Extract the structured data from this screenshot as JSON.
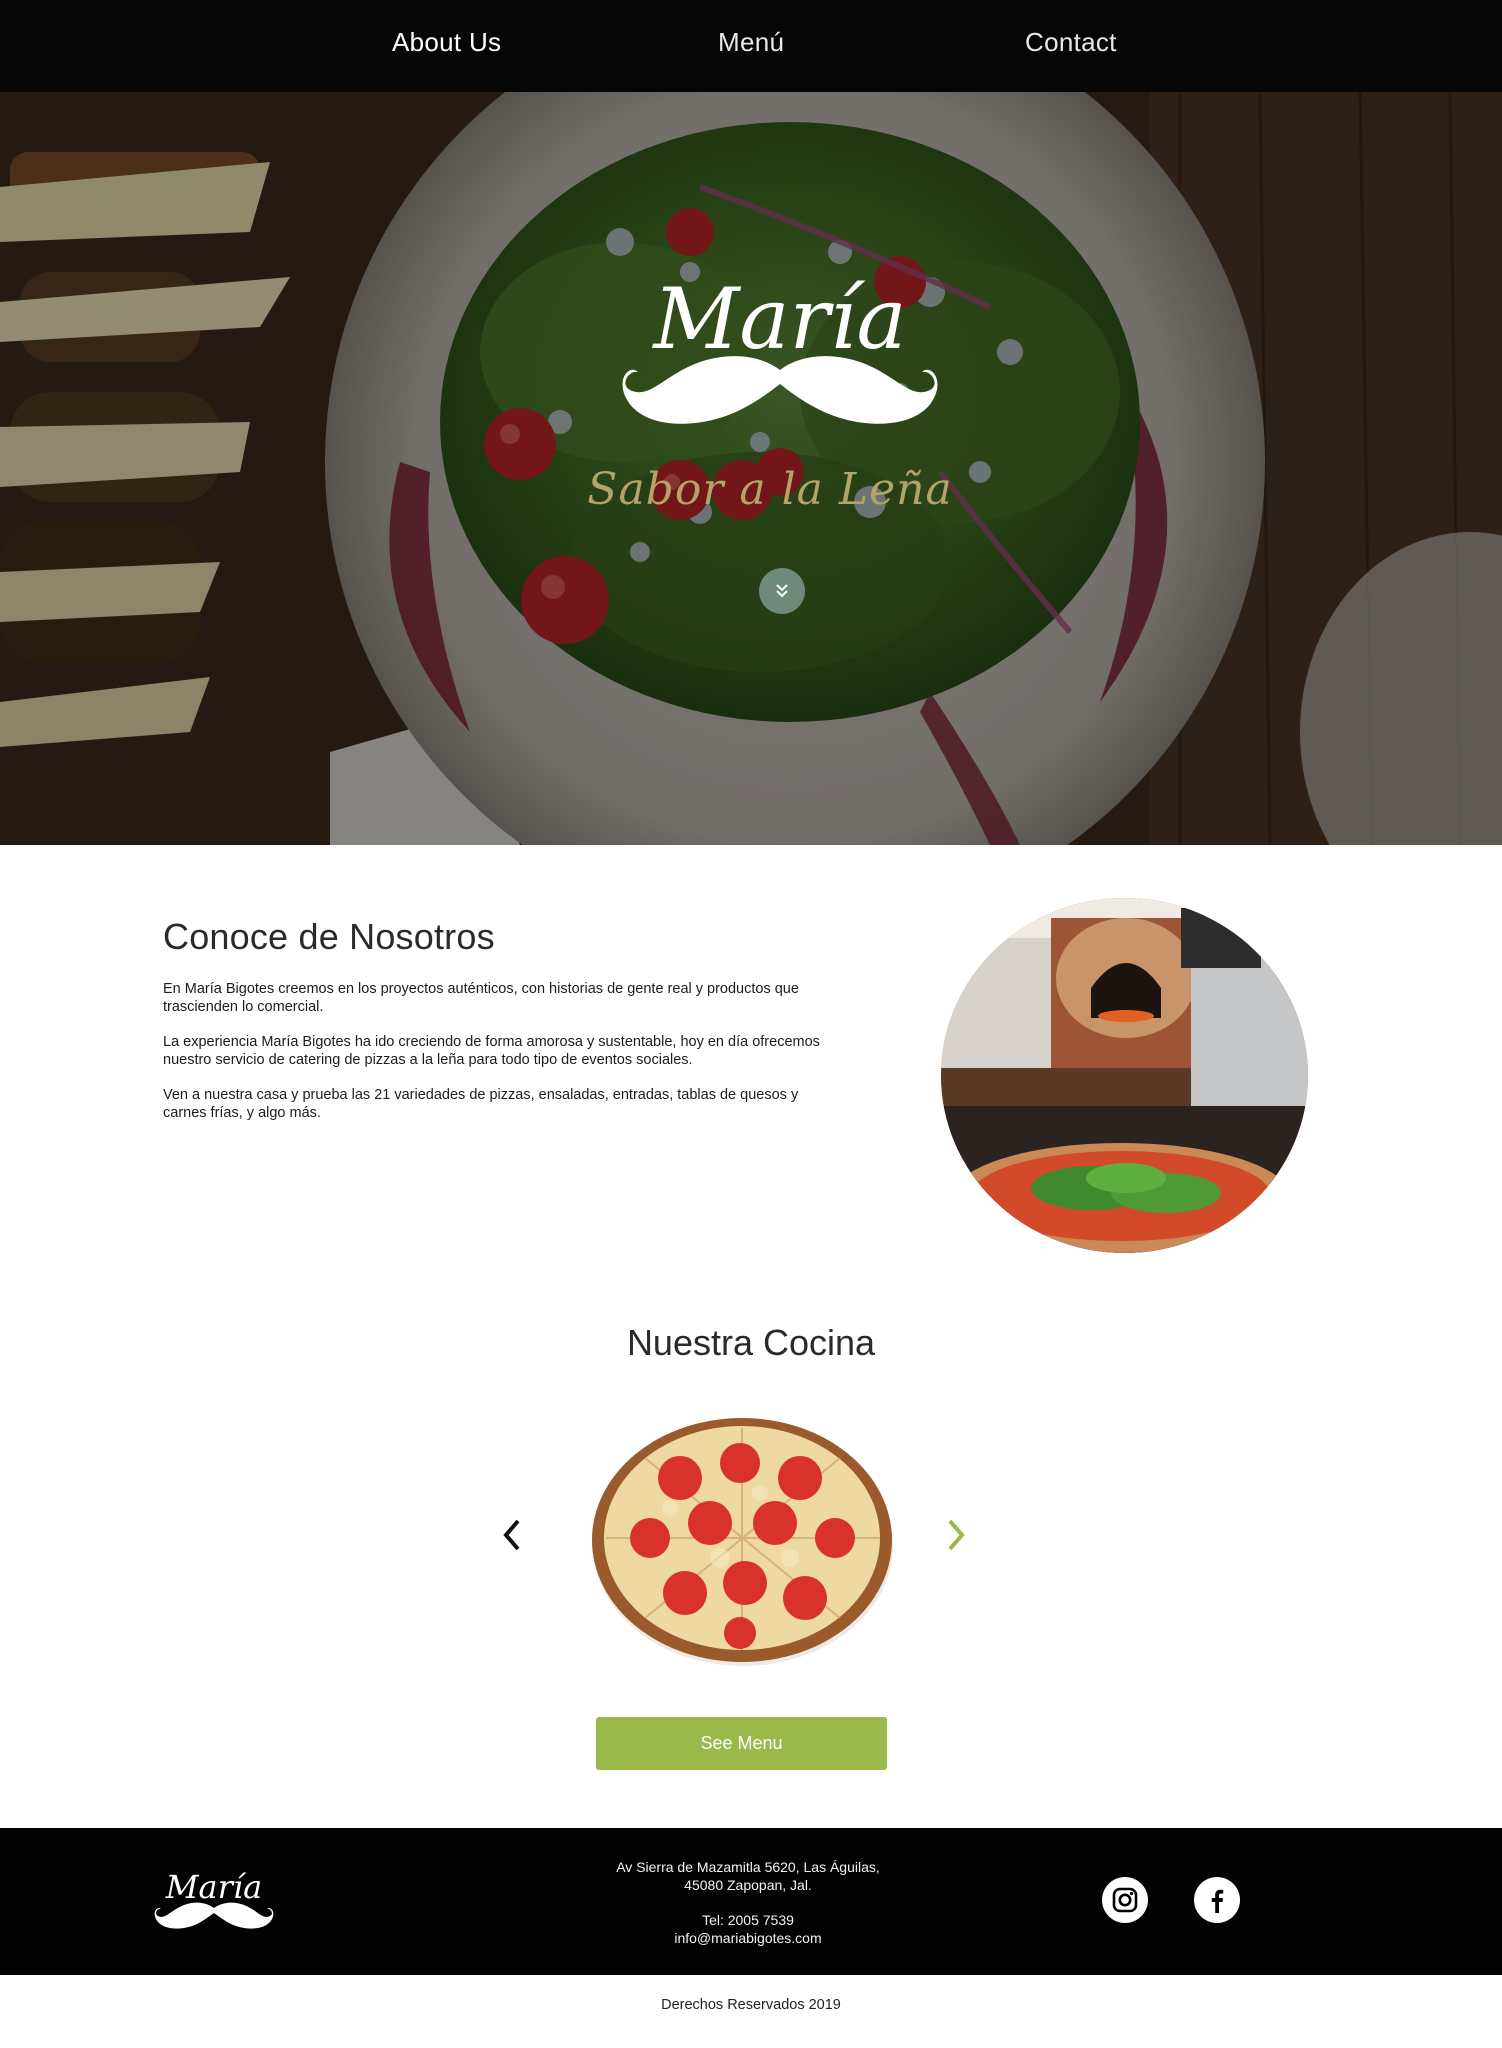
{
  "nav": {
    "about": "About Us",
    "menu": "Menú",
    "contact": "Contact"
  },
  "hero": {
    "logo_text": "María",
    "tagline": "Sabor a la Leña",
    "scroll_icon": "double-chevron-down-icon"
  },
  "about": {
    "title": "Conoce de Nosotros",
    "paragraphs": [
      "En María Bigotes creemos en los proyectos auténticos, con historias de gente real y productos que trascienden lo comercial.",
      "La experiencia María Bigotes ha ido creciendo de forma amorosa y sustentable, hoy en día ofrecemos nuestro servicio de catering de pizzas a la leña para todo tipo de eventos sociales.",
      "Ven a nuestra casa  y prueba las 21 variedades de pizzas, ensaladas, entradas, tablas de quesos y carnes frías, y algo más."
    ]
  },
  "cocina": {
    "title": "Nuestra Cocina",
    "button": "See Menu"
  },
  "footer": {
    "logo_text": "María",
    "address_line1": "Av Sierra de Mazamitla 5620, Las Águilas,",
    "address_line2": "45080 Zapopan, Jal.",
    "phone": "Tel: 2005 7539",
    "email": "info@mariabigotes.com",
    "social": [
      "instagram-icon",
      "facebook-icon"
    ]
  },
  "copyright": "Derechos Reservados 2019",
  "colors": {
    "accent": "#9ab94b",
    "tagline": "#b4a46a",
    "nav_bg": "#060606",
    "footer_bg": "#030303"
  }
}
